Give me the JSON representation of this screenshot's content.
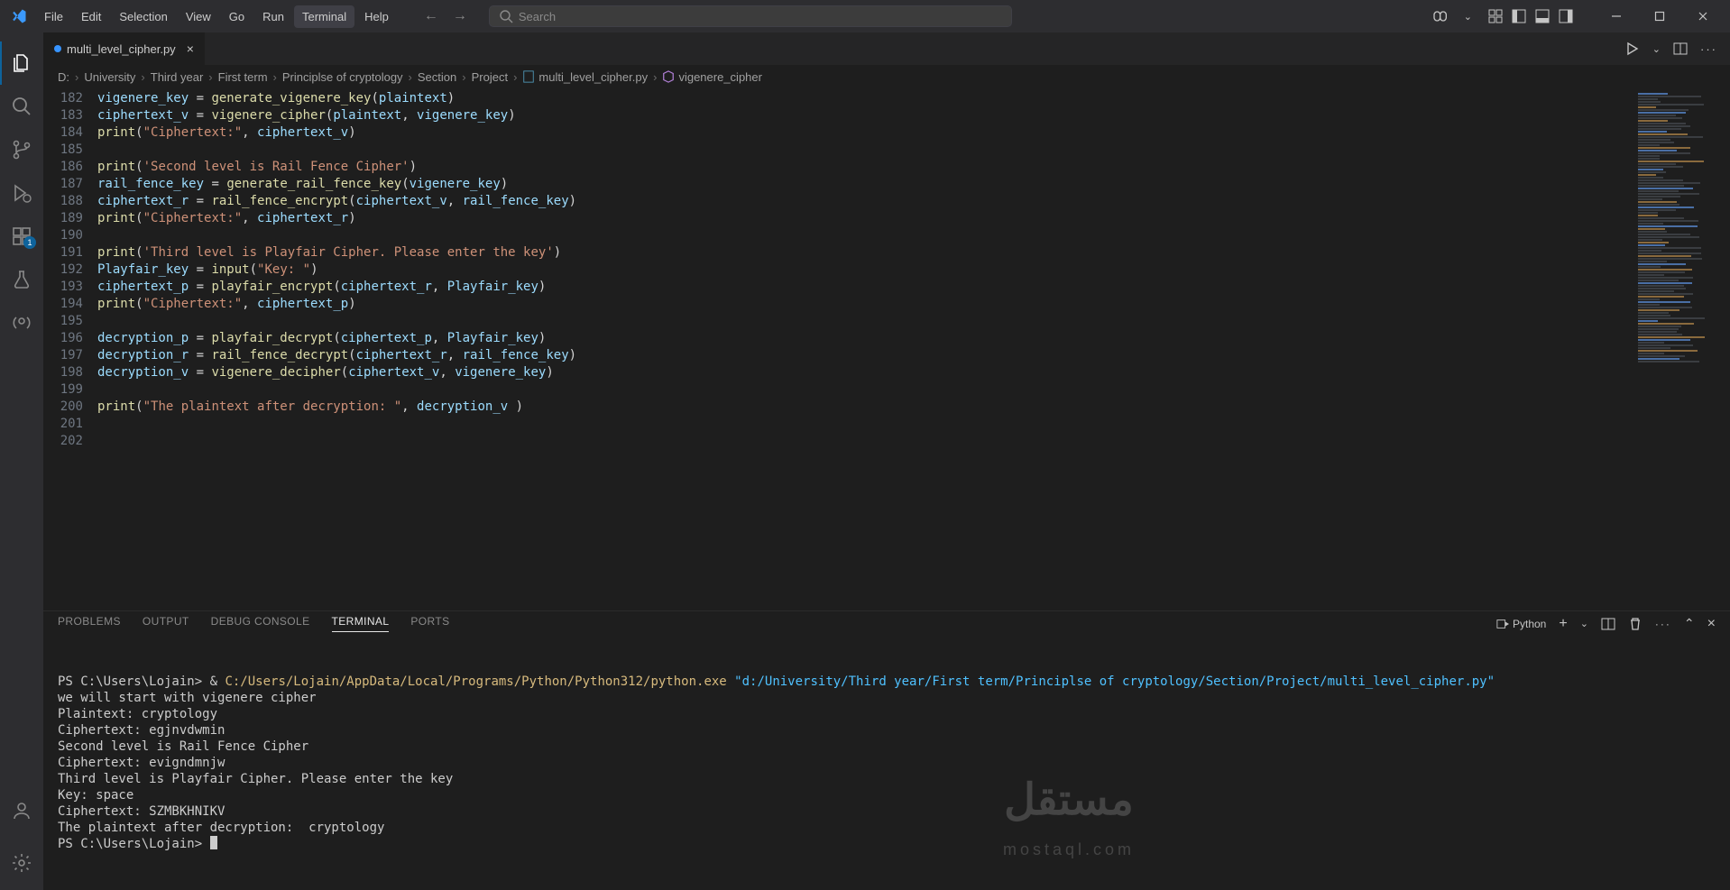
{
  "menu": [
    "File",
    "Edit",
    "Selection",
    "View",
    "Go",
    "Run",
    "Terminal",
    "Help"
  ],
  "menu_active_index": 6,
  "search_placeholder": "Search",
  "tab": {
    "filename": "multi_level_cipher.py"
  },
  "breadcrumb": {
    "parts": [
      "D:",
      "University",
      "Third year",
      "First term",
      "Principlse of cryptology",
      "Section",
      "Project"
    ],
    "file": "multi_level_cipher.py",
    "symbol": "vigenere_cipher"
  },
  "line_start": 182,
  "code_lines": [
    [
      [
        "var",
        "vigenere_key"
      ],
      [
        "op",
        " = "
      ],
      [
        "fn",
        "generate_vigenere_key"
      ],
      [
        "par",
        "("
      ],
      [
        "var",
        "plaintext"
      ],
      [
        "par",
        ")"
      ]
    ],
    [
      [
        "var",
        "ciphertext_v"
      ],
      [
        "op",
        " = "
      ],
      [
        "fn",
        "vigenere_cipher"
      ],
      [
        "par",
        "("
      ],
      [
        "var",
        "plaintext"
      ],
      [
        "op",
        ", "
      ],
      [
        "var",
        "vigenere_key"
      ],
      [
        "par",
        ")"
      ]
    ],
    [
      [
        "fn",
        "print"
      ],
      [
        "par",
        "("
      ],
      [
        "str",
        "\"Ciphertext:\""
      ],
      [
        "op",
        ", "
      ],
      [
        "var",
        "ciphertext_v"
      ],
      [
        "par",
        ")"
      ]
    ],
    [],
    [
      [
        "fn",
        "print"
      ],
      [
        "par",
        "("
      ],
      [
        "str",
        "'Second level is Rail Fence Cipher'"
      ],
      [
        "par",
        ")"
      ]
    ],
    [
      [
        "var",
        "rail_fence_key"
      ],
      [
        "op",
        " = "
      ],
      [
        "fn",
        "generate_rail_fence_key"
      ],
      [
        "par",
        "("
      ],
      [
        "var",
        "vigenere_key"
      ],
      [
        "par",
        ")"
      ]
    ],
    [
      [
        "var",
        "ciphertext_r"
      ],
      [
        "op",
        " = "
      ],
      [
        "fn",
        "rail_fence_encrypt"
      ],
      [
        "par",
        "("
      ],
      [
        "var",
        "ciphertext_v"
      ],
      [
        "op",
        ", "
      ],
      [
        "var",
        "rail_fence_key"
      ],
      [
        "par",
        ")"
      ]
    ],
    [
      [
        "fn",
        "print"
      ],
      [
        "par",
        "("
      ],
      [
        "str",
        "\"Ciphertext:\""
      ],
      [
        "op",
        ", "
      ],
      [
        "var",
        "ciphertext_r"
      ],
      [
        "par",
        ")"
      ]
    ],
    [],
    [
      [
        "fn",
        "print"
      ],
      [
        "par",
        "("
      ],
      [
        "str",
        "'Third level is Playfair Cipher. Please enter the key'"
      ],
      [
        "par",
        ")"
      ]
    ],
    [
      [
        "var",
        "Playfair_key"
      ],
      [
        "op",
        " = "
      ],
      [
        "fn",
        "input"
      ],
      [
        "par",
        "("
      ],
      [
        "str",
        "\"Key: \""
      ],
      [
        "par",
        ")"
      ]
    ],
    [
      [
        "var",
        "ciphertext_p"
      ],
      [
        "op",
        " = "
      ],
      [
        "fn",
        "playfair_encrypt"
      ],
      [
        "par",
        "("
      ],
      [
        "var",
        "ciphertext_r"
      ],
      [
        "op",
        ", "
      ],
      [
        "var",
        "Playfair_key"
      ],
      [
        "par",
        ")"
      ]
    ],
    [
      [
        "fn",
        "print"
      ],
      [
        "par",
        "("
      ],
      [
        "str",
        "\"Ciphertext:\""
      ],
      [
        "op",
        ", "
      ],
      [
        "var",
        "ciphertext_p"
      ],
      [
        "par",
        ")"
      ]
    ],
    [],
    [
      [
        "var",
        "decryption_p"
      ],
      [
        "op",
        " = "
      ],
      [
        "fn",
        "playfair_decrypt"
      ],
      [
        "par",
        "("
      ],
      [
        "var",
        "ciphertext_p"
      ],
      [
        "op",
        ", "
      ],
      [
        "var",
        "Playfair_key"
      ],
      [
        "par",
        ")"
      ]
    ],
    [
      [
        "var",
        "decryption_r"
      ],
      [
        "op",
        " = "
      ],
      [
        "fn",
        "rail_fence_decrypt"
      ],
      [
        "par",
        "("
      ],
      [
        "var",
        "ciphertext_r"
      ],
      [
        "op",
        ", "
      ],
      [
        "var",
        "rail_fence_key"
      ],
      [
        "par",
        ")"
      ]
    ],
    [
      [
        "var",
        "decryption_v"
      ],
      [
        "op",
        " = "
      ],
      [
        "fn",
        "vigenere_decipher"
      ],
      [
        "par",
        "("
      ],
      [
        "var",
        "ciphertext_v"
      ],
      [
        "op",
        ", "
      ],
      [
        "var",
        "vigenere_key"
      ],
      [
        "par",
        ")"
      ]
    ],
    [],
    [
      [
        "fn",
        "print"
      ],
      [
        "par",
        "("
      ],
      [
        "str",
        "\"The plaintext after decryption: \""
      ],
      [
        "op",
        ", "
      ],
      [
        "var",
        "decryption_v"
      ],
      [
        "op",
        " "
      ],
      [
        "par",
        ")"
      ]
    ],
    [],
    []
  ],
  "panel_tabs": [
    "PROBLEMS",
    "OUTPUT",
    "DEBUG CONSOLE",
    "TERMINAL",
    "PORTS"
  ],
  "panel_active_index": 3,
  "launch_profile": "Python",
  "terminal": {
    "prompt1_prefix": "PS C:\\Users\\Lojain> ",
    "amp": "& ",
    "exe_path": "C:/Users/Lojain/AppData/Local/Programs/Python/Python312/python.exe ",
    "script_arg": "\"d:/University/Third year/First term/Principlse of cryptology/Section/Project/multi_level_cipher.py\"",
    "lines": [
      "we will start with vigenere cipher",
      "Plaintext: cryptology",
      "Ciphertext: egjnvdwmin",
      "Second level is Rail Fence Cipher",
      "Ciphertext: evigndmnjw",
      "Third level is Playfair Cipher. Please enter the key",
      "Key: space",
      "Ciphertext: SZMBKHNIKV",
      "The plaintext after decryption:  cryptology"
    ],
    "prompt2": "PS C:\\Users\\Lojain> "
  },
  "ext_badge": "1",
  "watermark": {
    "big": "مستقل",
    "small": "mostaql.com"
  }
}
